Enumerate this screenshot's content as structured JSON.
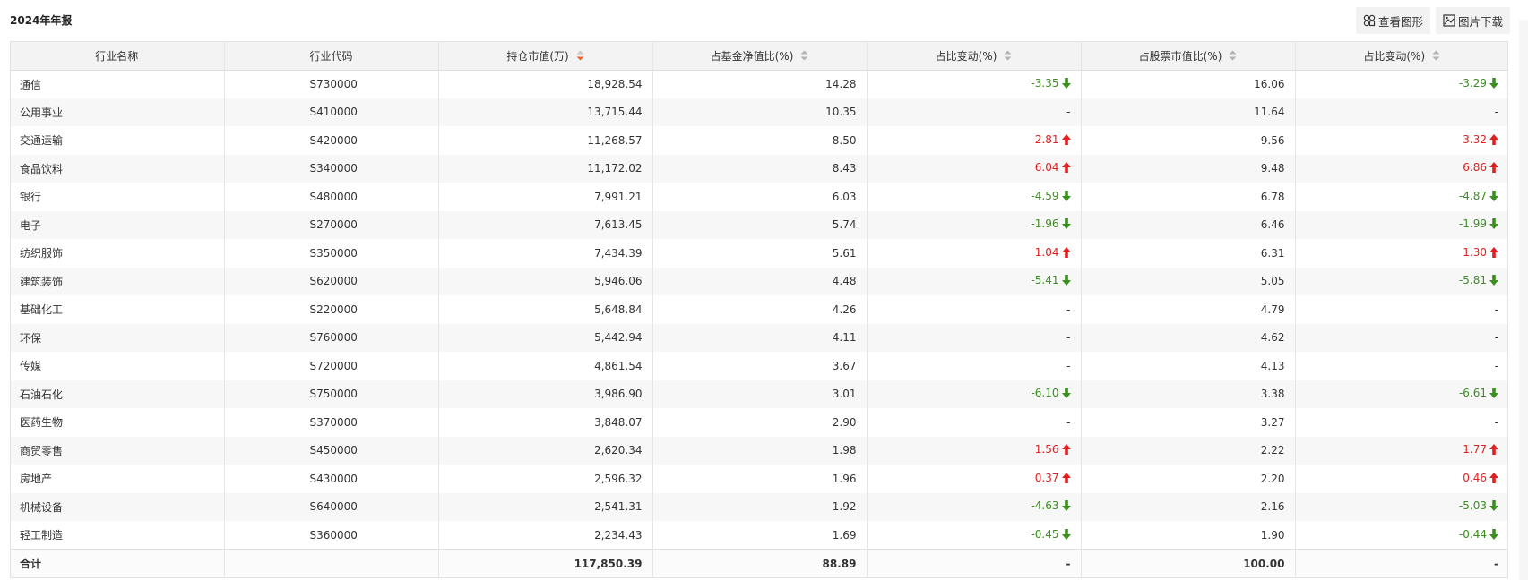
{
  "report": {
    "title": "2024年年报",
    "view_chart_label": "查看图形",
    "download_image_label": "图片下载"
  },
  "table": {
    "columns": [
      "行业名称",
      "行业代码",
      "持仓市值(万)",
      "占基金净值比(%)",
      "占比变动(%)",
      "占股票市值比(%)",
      "占比变动(%)"
    ],
    "sort_column": 2,
    "rows": [
      {
        "name": "通信",
        "code": "S730000",
        "value": "18,928.54",
        "nav_pct": "14.28",
        "nav_chg": "-3.35",
        "nav_dir": "down",
        "stock_pct": "16.06",
        "stock_chg": "-3.29",
        "stock_dir": "down"
      },
      {
        "name": "公用事业",
        "code": "S410000",
        "value": "13,715.44",
        "nav_pct": "10.35",
        "nav_chg": "-",
        "nav_dir": "none",
        "stock_pct": "11.64",
        "stock_chg": "-",
        "stock_dir": "none"
      },
      {
        "name": "交通运输",
        "code": "S420000",
        "value": "11,268.57",
        "nav_pct": "8.50",
        "nav_chg": "2.81",
        "nav_dir": "up",
        "stock_pct": "9.56",
        "stock_chg": "3.32",
        "stock_dir": "up"
      },
      {
        "name": "食品饮料",
        "code": "S340000",
        "value": "11,172.02",
        "nav_pct": "8.43",
        "nav_chg": "6.04",
        "nav_dir": "up",
        "stock_pct": "9.48",
        "stock_chg": "6.86",
        "stock_dir": "up"
      },
      {
        "name": "银行",
        "code": "S480000",
        "value": "7,991.21",
        "nav_pct": "6.03",
        "nav_chg": "-4.59",
        "nav_dir": "down",
        "stock_pct": "6.78",
        "stock_chg": "-4.87",
        "stock_dir": "down"
      },
      {
        "name": "电子",
        "code": "S270000",
        "value": "7,613.45",
        "nav_pct": "5.74",
        "nav_chg": "-1.96",
        "nav_dir": "down",
        "stock_pct": "6.46",
        "stock_chg": "-1.99",
        "stock_dir": "down"
      },
      {
        "name": "纺织服饰",
        "code": "S350000",
        "value": "7,434.39",
        "nav_pct": "5.61",
        "nav_chg": "1.04",
        "nav_dir": "up",
        "stock_pct": "6.31",
        "stock_chg": "1.30",
        "stock_dir": "up"
      },
      {
        "name": "建筑装饰",
        "code": "S620000",
        "value": "5,946.06",
        "nav_pct": "4.48",
        "nav_chg": "-5.41",
        "nav_dir": "down",
        "stock_pct": "5.05",
        "stock_chg": "-5.81",
        "stock_dir": "down"
      },
      {
        "name": "基础化工",
        "code": "S220000",
        "value": "5,648.84",
        "nav_pct": "4.26",
        "nav_chg": "-",
        "nav_dir": "none",
        "stock_pct": "4.79",
        "stock_chg": "-",
        "stock_dir": "none"
      },
      {
        "name": "环保",
        "code": "S760000",
        "value": "5,442.94",
        "nav_pct": "4.11",
        "nav_chg": "-",
        "nav_dir": "none",
        "stock_pct": "4.62",
        "stock_chg": "-",
        "stock_dir": "none"
      },
      {
        "name": "传媒",
        "code": "S720000",
        "value": "4,861.54",
        "nav_pct": "3.67",
        "nav_chg": "-",
        "nav_dir": "none",
        "stock_pct": "4.13",
        "stock_chg": "-",
        "stock_dir": "none"
      },
      {
        "name": "石油石化",
        "code": "S750000",
        "value": "3,986.90",
        "nav_pct": "3.01",
        "nav_chg": "-6.10",
        "nav_dir": "down",
        "stock_pct": "3.38",
        "stock_chg": "-6.61",
        "stock_dir": "down"
      },
      {
        "name": "医药生物",
        "code": "S370000",
        "value": "3,848.07",
        "nav_pct": "2.90",
        "nav_chg": "-",
        "nav_dir": "none",
        "stock_pct": "3.27",
        "stock_chg": "-",
        "stock_dir": "none"
      },
      {
        "name": "商贸零售",
        "code": "S450000",
        "value": "2,620.34",
        "nav_pct": "1.98",
        "nav_chg": "1.56",
        "nav_dir": "up",
        "stock_pct": "2.22",
        "stock_chg": "1.77",
        "stock_dir": "up"
      },
      {
        "name": "房地产",
        "code": "S430000",
        "value": "2,596.32",
        "nav_pct": "1.96",
        "nav_chg": "0.37",
        "nav_dir": "up",
        "stock_pct": "2.20",
        "stock_chg": "0.46",
        "stock_dir": "up"
      },
      {
        "name": "机械设备",
        "code": "S640000",
        "value": "2,541.31",
        "nav_pct": "1.92",
        "nav_chg": "-4.63",
        "nav_dir": "down",
        "stock_pct": "2.16",
        "stock_chg": "-5.03",
        "stock_dir": "down"
      },
      {
        "name": "轻工制造",
        "code": "S360000",
        "value": "2,234.43",
        "nav_pct": "1.69",
        "nav_chg": "-0.45",
        "nav_dir": "down",
        "stock_pct": "1.90",
        "stock_chg": "-0.44",
        "stock_dir": "down"
      }
    ],
    "total": {
      "name": "合计",
      "code": "",
      "value": "117,850.39",
      "nav_pct": "88.89",
      "nav_chg": "-",
      "stock_pct": "100.00",
      "stock_chg": "-"
    }
  },
  "colors": {
    "up": "#e02020",
    "down": "#3a8f1e",
    "sort_active": "#f0642a"
  }
}
